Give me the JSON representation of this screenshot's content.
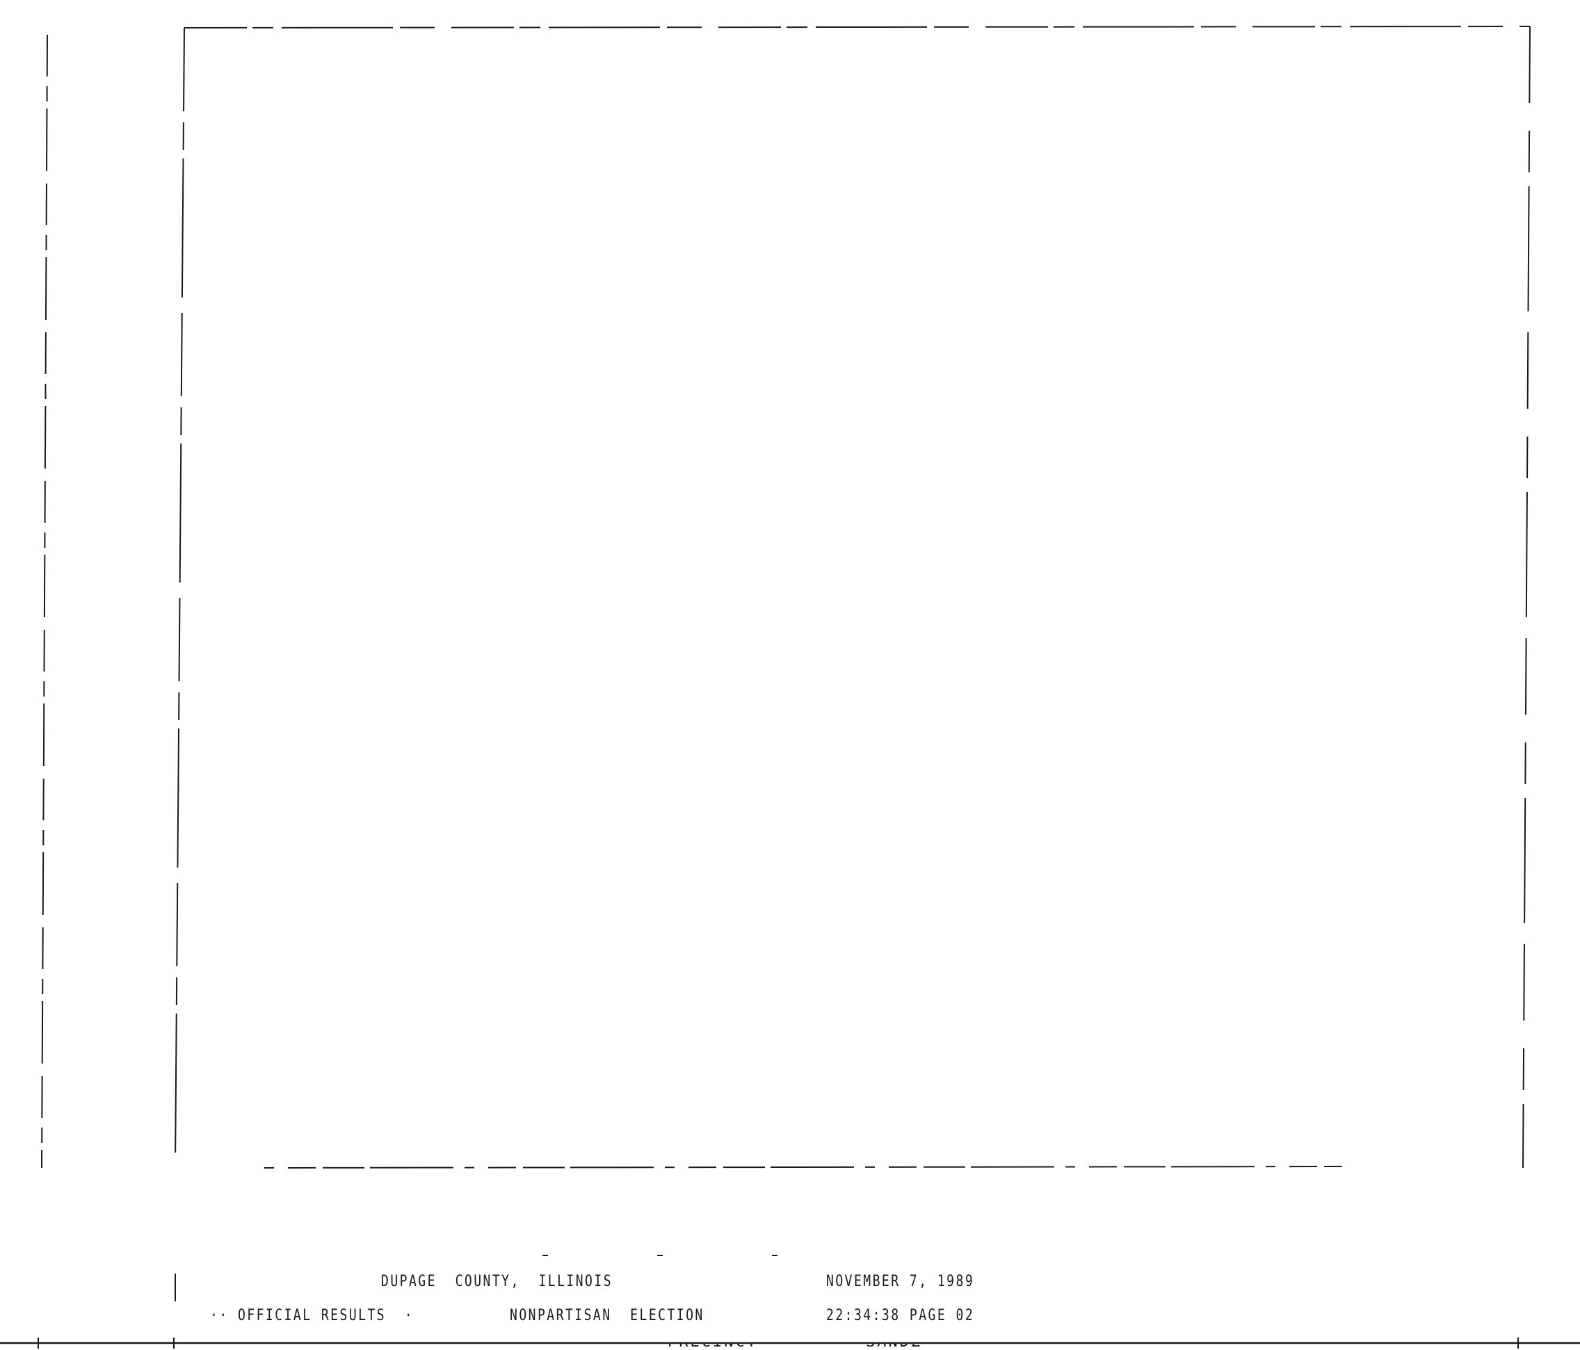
{
  "report": {
    "county": "DUPAGE  COUNTY,  ILLINOIS",
    "date": "NOVEMBER 7, 1989",
    "status": "·· OFFICIAL RESULTS  ·",
    "election": "NONPARTISAN  ELECTION",
    "timestamp": "22:34:38 PAGE 02",
    "column_heads": [
      "PRECINCT",
      "SANDZ"
    ]
  },
  "colors": {
    "ink": "#1a1a1a",
    "paper": "#ffffff"
  }
}
